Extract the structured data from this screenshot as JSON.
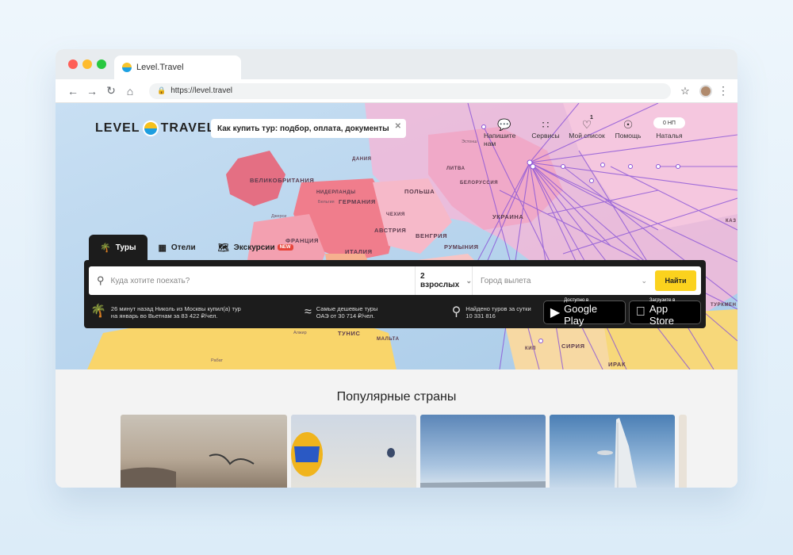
{
  "browser": {
    "tab_title": "Level.Travel",
    "url": "https://level.travel"
  },
  "header": {
    "logo_left": "LEVEL",
    "logo_right": "TRAVEL",
    "promo_text": "Как купить тур: подбор, оплата, документы",
    "actions": [
      {
        "label": "Напишите нам",
        "icon": "chat-icon"
      },
      {
        "label": "Сервисы",
        "icon": "grid-icon"
      },
      {
        "label": "Мой список",
        "icon": "heart-icon",
        "badge": "1"
      },
      {
        "label": "Помощь",
        "icon": "lifebuoy-icon"
      },
      {
        "label": "Наталья",
        "icon": "user-icon",
        "pill": "0  НП"
      }
    ]
  },
  "map_labels": {
    "countries": [
      "ВЕЛИКОБРИТАНИЯ",
      "ГЕРМАНИЯ",
      "ПОЛЬША",
      "ФРАНЦИЯ",
      "ИТАЛИЯ",
      "УКРАИНА",
      "РУМЫНИЯ",
      "АВСТРИЯ",
      "ВЕНГРИЯ",
      "ЧЕХИЯ",
      "ДАНИЯ",
      "ЛИТВА",
      "БЕЛОРУССИЯ",
      "НИДЕРЛАНДЫ",
      "ТУНИС",
      "МАЛЬТА",
      "СИРИЯ",
      "ИРАК",
      "КИП",
      "ТУРКМЕН",
      "КАЗ"
    ],
    "cities": [
      "Эстонш",
      "Джерси",
      "Бельгия",
      "Алжир",
      "Рабат"
    ]
  },
  "search": {
    "tabs": [
      {
        "label": "Туры",
        "icon": "palm-icon"
      },
      {
        "label": "Отели",
        "icon": "hotel-icon"
      },
      {
        "label": "Экскурсии",
        "icon": "map-icon",
        "badge": "NEW"
      }
    ],
    "destination_placeholder": "Куда хотите поехать?",
    "people": "2 взрослых",
    "city_placeholder": "Город вылета",
    "submit_label": "Найти"
  },
  "info": {
    "recent": "26 минут назад Николь из Москвы купил(а) тур на январь во Вьетнам за 83 422 ₽/чел.",
    "cheapest": "Самые дешевые туры ОАЭ от 30 714 ₽/чел.",
    "found": "Найдено туров за сутки 10 331 816",
    "google_small": "Доступно в",
    "google_big": "Google Play",
    "apple_small": "Загрузите в",
    "apple_big": "App Store"
  },
  "popular": {
    "title": "Популярные страны"
  },
  "colors": {
    "accent": "#fbd21e",
    "dark_panel": "#1c1c1c"
  }
}
